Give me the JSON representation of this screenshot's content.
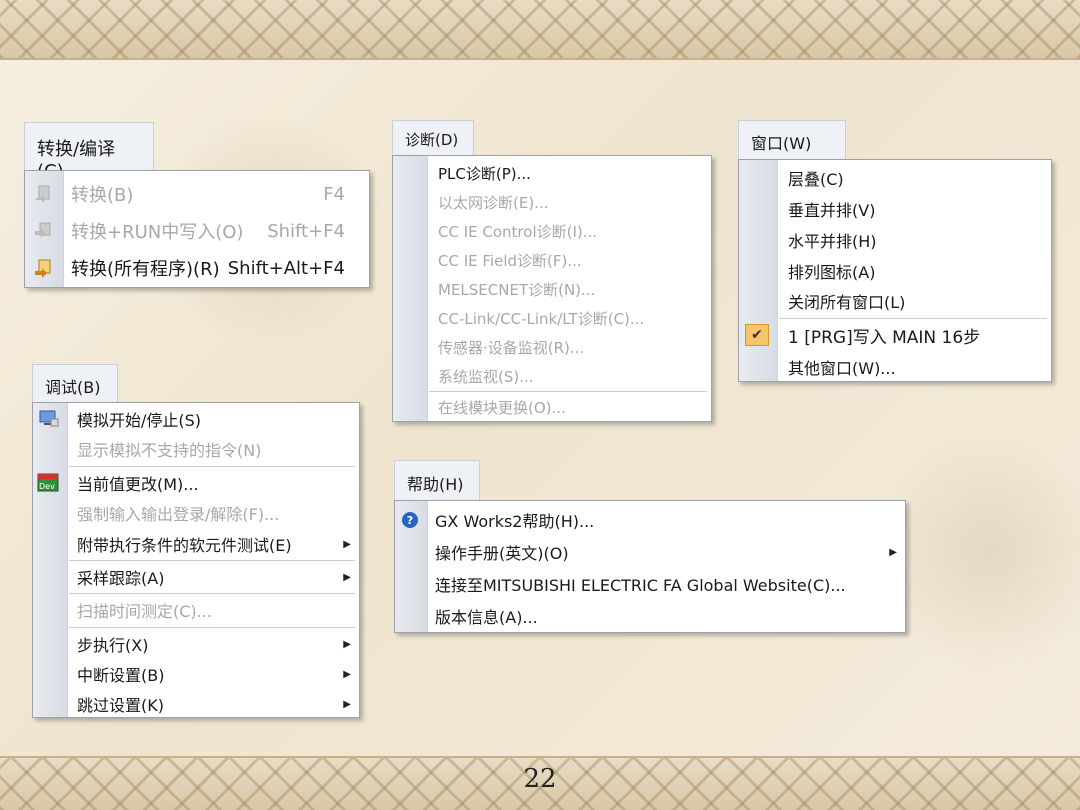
{
  "convert_menu": {
    "title": "转换/编译(C)",
    "items": [
      {
        "label": "转换(B)",
        "accel": "F4",
        "disabled": true
      },
      {
        "label": "转换+RUN中写入(O)",
        "accel": "Shift+F4",
        "disabled": true
      },
      {
        "label": "转换(所有程序)(R)",
        "accel": "Shift+Alt+F4",
        "disabled": false
      }
    ]
  },
  "debug_menu": {
    "title": "调试(B)",
    "items": [
      {
        "label": "模拟开始/停止(S)",
        "disabled": false
      },
      {
        "label": "显示模拟不支持的指令(N)",
        "disabled": true
      },
      {
        "label": "当前值更改(M)...",
        "disabled": false
      },
      {
        "label": "强制输入输出登录/解除(F)...",
        "disabled": true
      },
      {
        "label": "附带执行条件的软元件测试(E)",
        "disabled": false,
        "submenu": true
      },
      {
        "label": "采样跟踪(A)",
        "disabled": false,
        "submenu": true
      },
      {
        "label": "扫描时间测定(C)...",
        "disabled": true
      },
      {
        "label": "步执行(X)",
        "disabled": false,
        "submenu": true
      },
      {
        "label": "中断设置(B)",
        "disabled": false,
        "submenu": true
      },
      {
        "label": "跳过设置(K)",
        "disabled": false,
        "submenu": true
      }
    ],
    "icon_text": "Dev"
  },
  "diag_menu": {
    "title": "诊断(D)",
    "items": [
      {
        "label": "PLC诊断(P)...",
        "disabled": false
      },
      {
        "label": "以太网诊断(E)...",
        "disabled": true
      },
      {
        "label": "CC IE Control诊断(I)...",
        "disabled": true
      },
      {
        "label": "CC IE Field诊断(F)...",
        "disabled": true
      },
      {
        "label": "MELSECNET诊断(N)...",
        "disabled": true
      },
      {
        "label": "CC-Link/CC-Link/LT诊断(C)...",
        "disabled": true
      },
      {
        "label": "传感器·设备监视(R)...",
        "disabled": true
      },
      {
        "label": "系统监视(S)...",
        "disabled": true
      },
      {
        "label": "在线模块更换(O)...",
        "disabled": true
      }
    ]
  },
  "window_menu": {
    "title": "窗口(W)",
    "items": [
      {
        "label": "层叠(C)"
      },
      {
        "label": "垂直并排(V)"
      },
      {
        "label": "水平并排(H)"
      },
      {
        "label": "排列图标(A)"
      },
      {
        "label": "关闭所有窗口(L)"
      },
      {
        "label": "1 [PRG]写入 MAIN 16步",
        "checked": true
      },
      {
        "label": "其他窗口(W)..."
      }
    ]
  },
  "help_menu": {
    "title": "帮助(H)",
    "items": [
      {
        "label": "GX Works2帮助(H)..."
      },
      {
        "label": "操作手册(英文)(O)",
        "submenu": true
      },
      {
        "label": "连接至MITSUBISHI ELECTRIC FA Global Website(C)..."
      },
      {
        "label": "版本信息(A)..."
      }
    ]
  },
  "page_number": "22",
  "colors": {
    "check_bg": "#f6c46a",
    "help_icon": "#2a63c4"
  }
}
